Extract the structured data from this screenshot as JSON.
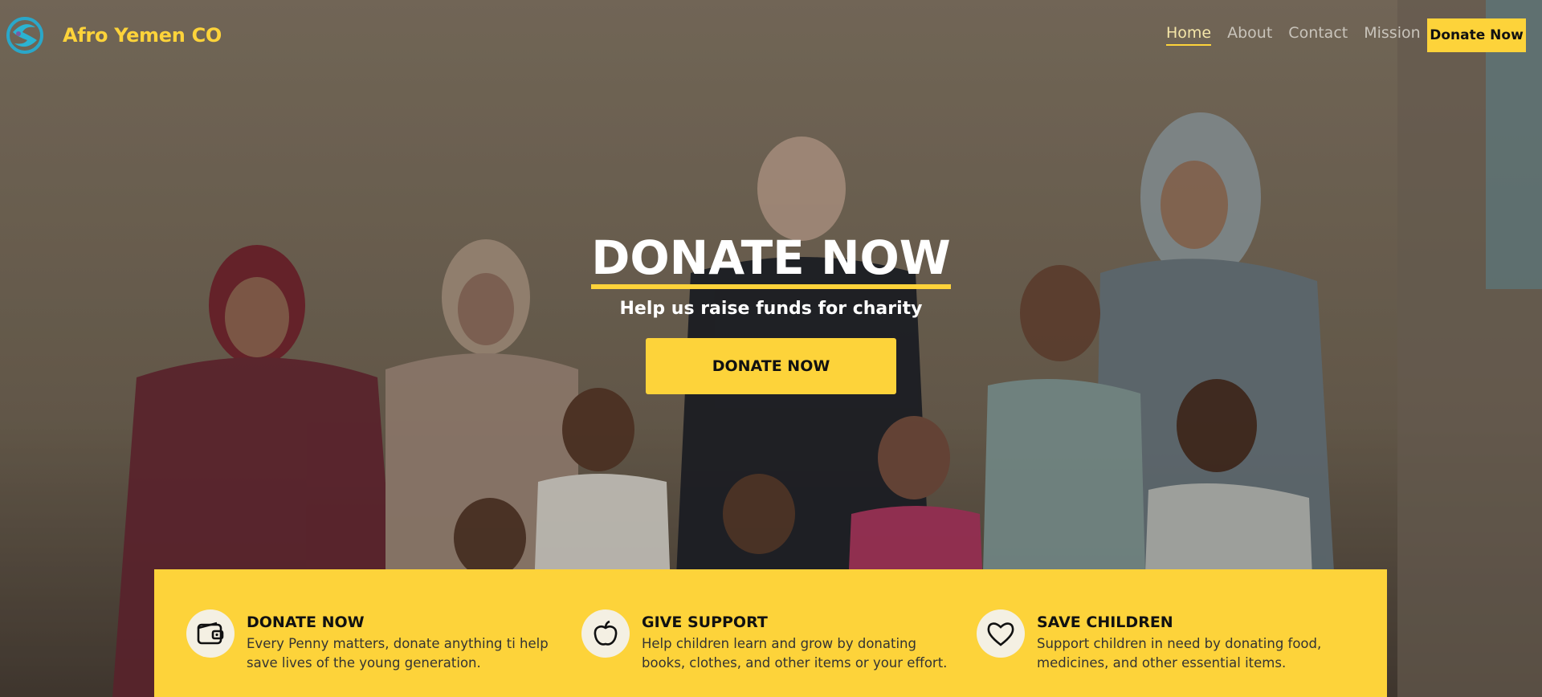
{
  "brand": {
    "name": "Afro Yemen CO",
    "logo_icon": "swirl-logo"
  },
  "nav": {
    "links": [
      {
        "label": "Home",
        "active": true
      },
      {
        "label": "About",
        "active": false
      },
      {
        "label": "Contact",
        "active": false
      },
      {
        "label": "Mission",
        "active": false
      }
    ],
    "cta_label": "Donate Now"
  },
  "hero": {
    "title": "DONATE NOW",
    "subtitle": "Help us raise funds for charity",
    "button_label": "DONATE NOW"
  },
  "features": [
    {
      "icon": "wallet-icon",
      "title": "DONATE NOW",
      "description": "Every Penny matters, donate anything ti help save lives of the young generation."
    },
    {
      "icon": "apple-icon",
      "title": "GIVE SUPPORT",
      "description": "Help children learn and grow by donating books, clothes, and other items or your effort."
    },
    {
      "icon": "heart-icon",
      "title": "SAVE CHILDREN",
      "description": "Support children in need by donating food, medicines, and other essential items."
    }
  ],
  "colors": {
    "accent": "#fdd33a",
    "text_dark": "#111111",
    "hero_text": "#ffffff"
  }
}
